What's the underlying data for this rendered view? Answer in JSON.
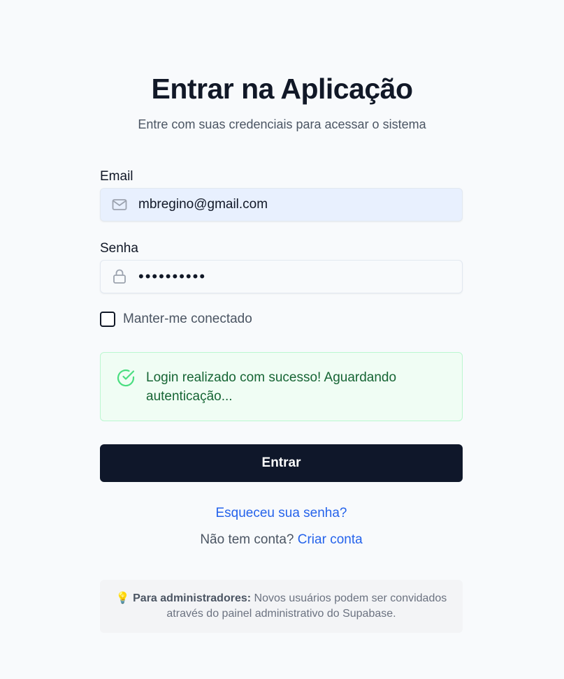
{
  "header": {
    "title": "Entrar na Aplicação",
    "subtitle": "Entre com suas credenciais para acessar o sistema"
  },
  "form": {
    "email_label": "Email",
    "email_value": "mbregino@gmail.com",
    "email_icon": "mail-icon",
    "password_label": "Senha",
    "password_value": "••••••••••",
    "password_icon": "lock-icon",
    "remember_label": "Manter-me conectado",
    "remember_checked": false
  },
  "alert": {
    "icon": "check-circle-icon",
    "text": "Login realizado com sucesso! Aguardando autenticação...",
    "color": "#166534"
  },
  "actions": {
    "submit_label": "Entrar",
    "forgot_label": "Esqueceu sua senha?",
    "signup_prompt": "Não tem conta?",
    "signup_link": "Criar conta"
  },
  "note": {
    "icon": "lightbulb-icon",
    "bold": "Para administradores:",
    "text": "Novos usuários podem ser convidados através do painel administrativo do Supabase."
  },
  "colors": {
    "primary": "#0f172a",
    "link": "#2563eb",
    "success_bg": "#f0fdf4",
    "success_border": "#bbf7d0"
  }
}
